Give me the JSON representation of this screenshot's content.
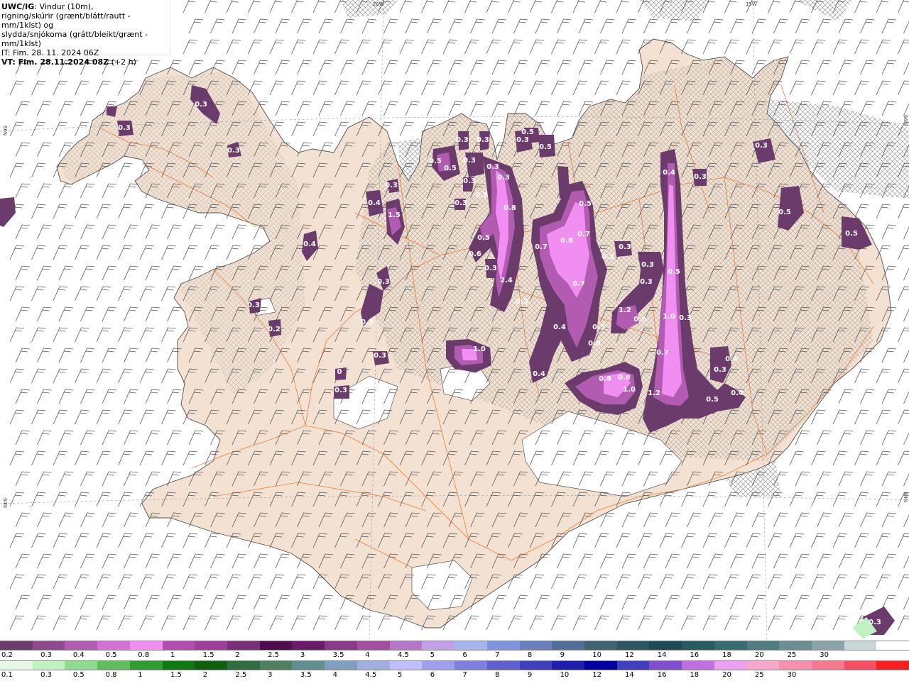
{
  "header": {
    "model": "UWC/IG",
    "line1_rest": ": Vindur (10m),",
    "line2": "rigning/skúrir (grænt/blátt/rautt - mm/1klst) og",
    "line3": "slydda/snjókoma (grátt/bleikt/grænt - mm/1klst)",
    "line4": "IT: Fim. 28. 11. 2024 06Z",
    "line5_bold": "VT: Fim. 28.11.2024 08Z",
    "line5_rest": " (+2 h)"
  },
  "grid_labels": {
    "top_left_lon": "20W",
    "top_right_lon": "15W",
    "left_upper_lat": "66N",
    "left_lower_lat": "64N",
    "right_upper_lat": "66N",
    "right_lower_lat": "64N"
  },
  "precip_labels": [
    "0.3",
    "0.3",
    "0.3",
    "0.4",
    "0.3",
    "0.2",
    "0.3",
    "0.3",
    "0",
    "0.3",
    "0.3",
    "1.5",
    "0.4",
    "0.3",
    "0.5",
    "0.5",
    "0.3",
    "0.3",
    "0.3",
    "0.3",
    "0.3",
    "0.3",
    "0.5",
    "0.5",
    "0.7",
    "0.8",
    "0.6",
    "0.5",
    "0.3",
    "0.3",
    "0.3",
    "0.5",
    "2.4",
    "0.3",
    "1.0",
    "0.7",
    "0.7",
    "0.8",
    "0.5",
    "0.4",
    "0.4",
    "0.5",
    "0.6",
    "0.3",
    "0.3",
    "0.3",
    "0.3",
    "1.2",
    "0.6",
    "0.4",
    "0.7",
    "1.0",
    "0.3",
    "0.7",
    "0.6",
    "0.8",
    "1.0",
    "1.2",
    "0.5",
    "0.3",
    "0.4",
    "0.4",
    "0.3",
    "0.5",
    "0.5",
    "0.3",
    "0.3"
  ],
  "colors": {
    "land": "#f3e2d2",
    "sea": "#ffffff",
    "roads": "#e8742e",
    "coast": "#555555",
    "glacier": "#ffffff"
  },
  "snow_scale": {
    "colors": [
      "#6b3c6b",
      "#8e4a8e",
      "#b15cb1",
      "#d46fd4",
      "#f18ef1",
      "#b24cb2",
      "#9b3f9b",
      "#7a2f7a",
      "#4e0e4e",
      "#6a1c6a",
      "#8b3a8b",
      "#a24fa2",
      "#b578c8",
      "#c3a0e6",
      "#a6b5ee",
      "#8193de",
      "#6b7fbe",
      "#516d9a",
      "#3f6471",
      "#2c5560",
      "#1f4a55",
      "#275a63",
      "#366c72",
      "#4f7d80",
      "#6a8f92",
      "#8aa4a8",
      "#c8d6d8",
      "#ffffff"
    ],
    "labels": [
      "0.2",
      "0.3",
      "0.4",
      "0.5",
      "0.8",
      "1",
      "1.5",
      "2",
      "2.5",
      "3",
      "3.5",
      "4",
      "4.5",
      "5",
      "6",
      "7",
      "8",
      "9",
      "10",
      "12",
      "14",
      "16",
      "18",
      "20",
      "25",
      "30"
    ]
  },
  "rain_scale": {
    "colors": [
      "#e6f9e6",
      "#bff2bf",
      "#8fdc8f",
      "#5fbe5f",
      "#2f9d2f",
      "#0f7a0f",
      "#0e5f0e",
      "#2f6f3f",
      "#4f7f5f",
      "#5f8f8f",
      "#7f9fbf",
      "#9fafdf",
      "#bfbfff",
      "#9f9fef",
      "#7f7fdf",
      "#5f5fcf",
      "#3f3fbf",
      "#1f1faf",
      "#0000a0",
      "#3f3fbf",
      "#7f4fcf",
      "#bf6fdf",
      "#ef9fef",
      "#f7a7c7",
      "#f78faf",
      "#f7778f",
      "#f74f5f",
      "#f71f1f"
    ],
    "labels": [
      "0.1",
      "0.3",
      "0.5",
      "0.8",
      "1",
      "1.5",
      "2",
      "2.5",
      "3",
      "3.5",
      "4",
      "4.5",
      "5",
      "6",
      "7",
      "8",
      "9",
      "10",
      "12",
      "14",
      "16",
      "18",
      "20",
      "25",
      "30"
    ]
  }
}
